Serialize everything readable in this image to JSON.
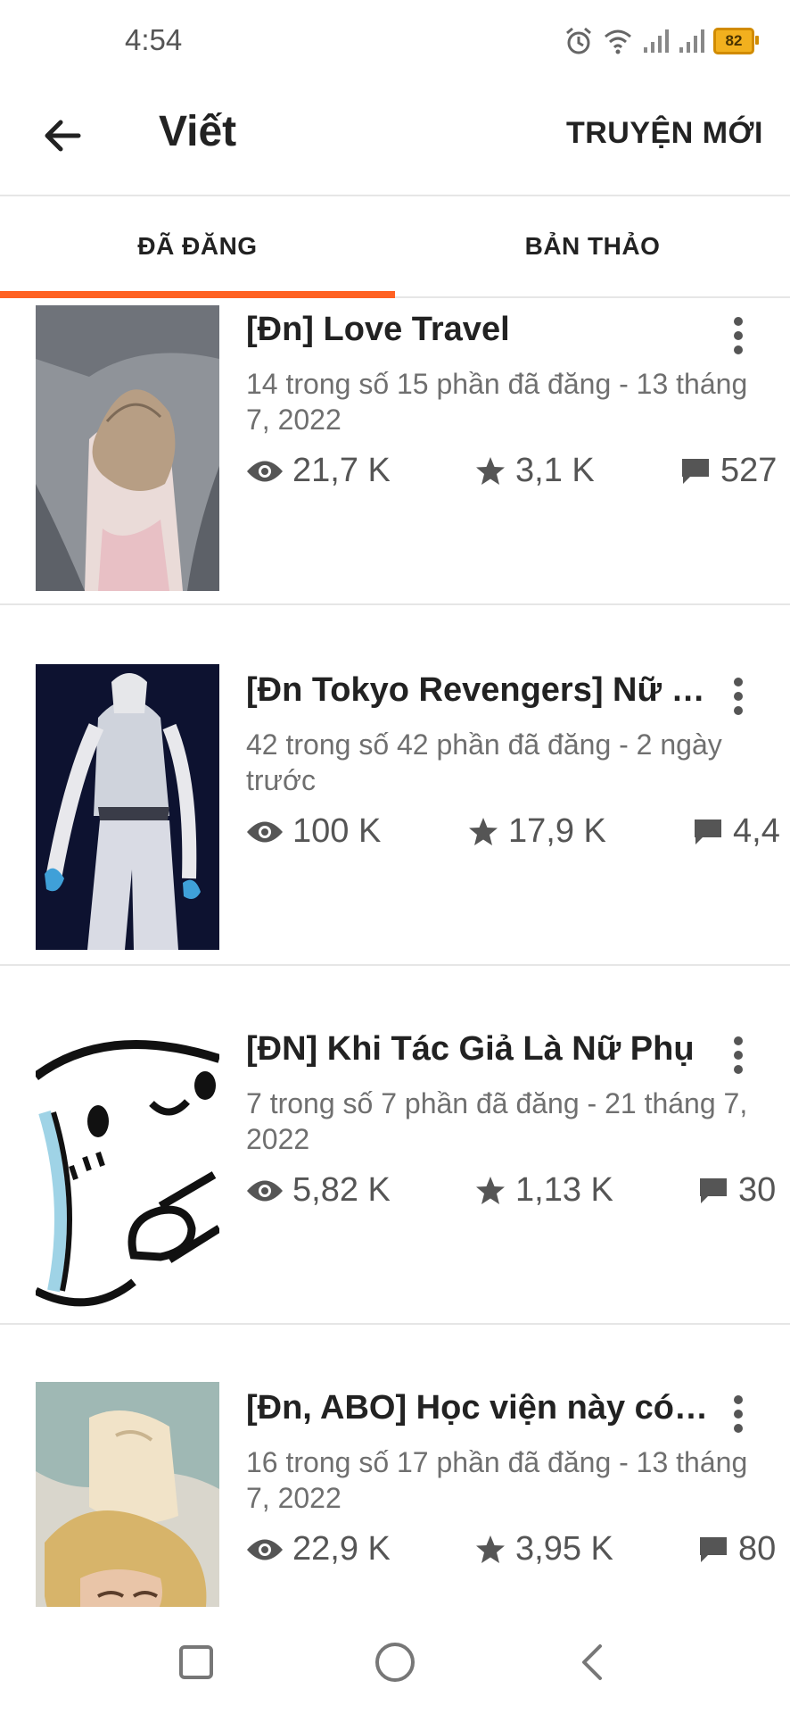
{
  "status_bar": {
    "time": "4:54",
    "battery": "82"
  },
  "app_bar": {
    "title": "Viết",
    "new_story_label": "TRUYỆN MỚI"
  },
  "tabs": [
    {
      "label": "ĐÃ ĐĂNG",
      "selected": true
    },
    {
      "label": "BẢN THẢO",
      "selected": false
    }
  ],
  "stories": [
    {
      "title": "[Đn] Love Travel",
      "meta": "14 trong số 15 phần đã đăng - 13 tháng 7, 2022",
      "views": "21,7 K",
      "votes": "3,1 K",
      "comments": "527"
    },
    {
      "title": "[Đn Tokyo Revengers] Nữ Q...",
      "meta": "42 trong số 42 phần đã đăng - 2 ngày trước",
      "views": "100 K",
      "votes": "17,9 K",
      "comments": "4,4"
    },
    {
      "title": "[ĐN] Khi Tác Giả Là Nữ Phụ",
      "meta": "7 trong số 7 phần đã đăng - 21 tháng 7, 2022",
      "views": "5,82 K",
      "votes": "1,13 K",
      "comments": "30"
    },
    {
      "title": "[Đn, ABO] Học viện này có ...",
      "meta": "16 trong số 17 phần đã đăng - 13 tháng 7, 2022",
      "views": "22,9 K",
      "votes": "3,95 K",
      "comments": "80"
    }
  ],
  "colors": {
    "accent": "#ff6122",
    "text": "#222222",
    "muted": "#6f6f6f"
  }
}
